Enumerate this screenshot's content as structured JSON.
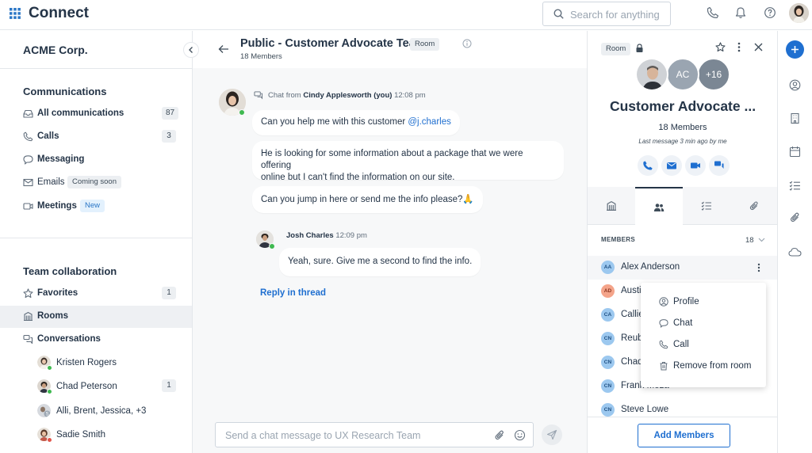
{
  "app": {
    "title": "Connect"
  },
  "search": {
    "placeholder": "Search for anything"
  },
  "sidebar": {
    "org": "ACME Corp.",
    "communications": {
      "title": "Communications",
      "items": [
        {
          "label": "All communications",
          "count": "87",
          "icon": "inbox-icon"
        },
        {
          "label": "Calls",
          "count": "3",
          "icon": "phone-icon"
        },
        {
          "label": "Messaging",
          "icon": "chat-icon"
        },
        {
          "label": "Emails",
          "tag": "Coming soon",
          "icon": "mail-icon"
        },
        {
          "label": "Meetings",
          "tag": "New",
          "icon": "video-icon"
        }
      ]
    },
    "team": {
      "title": "Team collaboration",
      "items": [
        {
          "label": "Favorites",
          "count": "1",
          "icon": "star-icon"
        },
        {
          "label": "Rooms",
          "icon": "building-icon"
        },
        {
          "label": "Conversations",
          "icon": "conversations-icon"
        }
      ],
      "conversations": [
        {
          "name": "Kristen Rogers"
        },
        {
          "name": "Chad Peterson",
          "count": "1"
        },
        {
          "name": "Alli, Brent, Jessica, +3"
        },
        {
          "name": "Sadie Smith"
        }
      ]
    }
  },
  "chat": {
    "title": "Public - Customer Advocate Team",
    "badge": "Room",
    "members": "18 Members",
    "messages": [
      {
        "from_prefix": "Chat from",
        "author": "Cindy Applesworth (you)",
        "time": "12:08 pm",
        "bubbles": [
          {
            "text": "Can you help me with this customer ",
            "mention": "@j.charles"
          },
          {
            "line1": "He is looking for some information about a package that we were offering",
            "line2": "online but I can't find the information on our site."
          },
          {
            "text": "Can you jump in here or send me the info please?🙏"
          }
        ]
      },
      {
        "author": "Josh Charles",
        "time": "12:09 pm",
        "bubbles": [
          {
            "text": "Yeah, sure. Give me a second to find the info."
          }
        ]
      }
    ],
    "reply_link": "Reply in thread",
    "composer_placeholder": "Send a chat message to UX Research Team"
  },
  "panel": {
    "badge": "Room",
    "avatar_initials": "AC",
    "avatar_more": "+16",
    "title": "Customer Advocate ...",
    "members": "18 Members",
    "last_message": "Last message 3 min ago by me",
    "members_label": "MEMBERS",
    "members_count": "18",
    "member_list": [
      {
        "initials": "AA",
        "name": "Alex Anderson",
        "color": "#9cc8ef"
      },
      {
        "initials": "AD",
        "name": "Austi",
        "color": "#f4a48a"
      },
      {
        "initials": "CA",
        "name": "Callie",
        "color": "#9cc8ef"
      },
      {
        "initials": "CN",
        "name": "Reube",
        "color": "#9cc8ef"
      },
      {
        "initials": "CN",
        "name": "Chad",
        "color": "#9cc8ef"
      },
      {
        "initials": "CN",
        "name": "Frank Meza",
        "color": "#9cc8ef"
      },
      {
        "initials": "CN",
        "name": "Steve Lowe",
        "color": "#9cc8ef"
      }
    ],
    "context_menu": [
      {
        "label": "Profile",
        "icon": "profile-icon"
      },
      {
        "label": "Chat",
        "icon": "chat-icon"
      },
      {
        "label": "Call",
        "icon": "phone-icon"
      },
      {
        "label": "Remove from room",
        "icon": "trash-icon"
      }
    ],
    "add_button": "Add Members"
  },
  "colors": {
    "accent": "#1f6fd0",
    "online": "#3fb950",
    "text": "#243447"
  }
}
